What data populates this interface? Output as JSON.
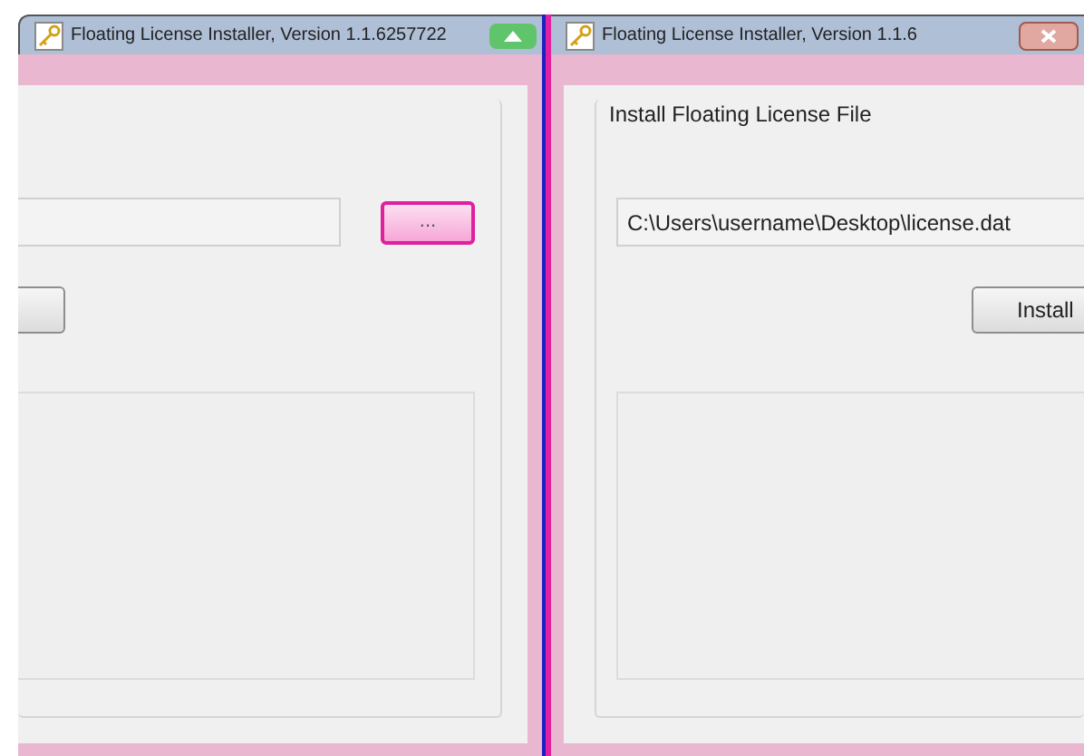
{
  "windows": [
    {
      "title": "Floating License Installer, Version 1.1.6257722",
      "browse_button": "...",
      "browse_highlighted": true
    },
    {
      "title": "Floating License Installer, Version 1.1.6",
      "group_label": "Install Floating License File",
      "path_value": "C:\\Users\\username\\Desktop\\license.dat",
      "action_button": "Install"
    }
  ]
}
